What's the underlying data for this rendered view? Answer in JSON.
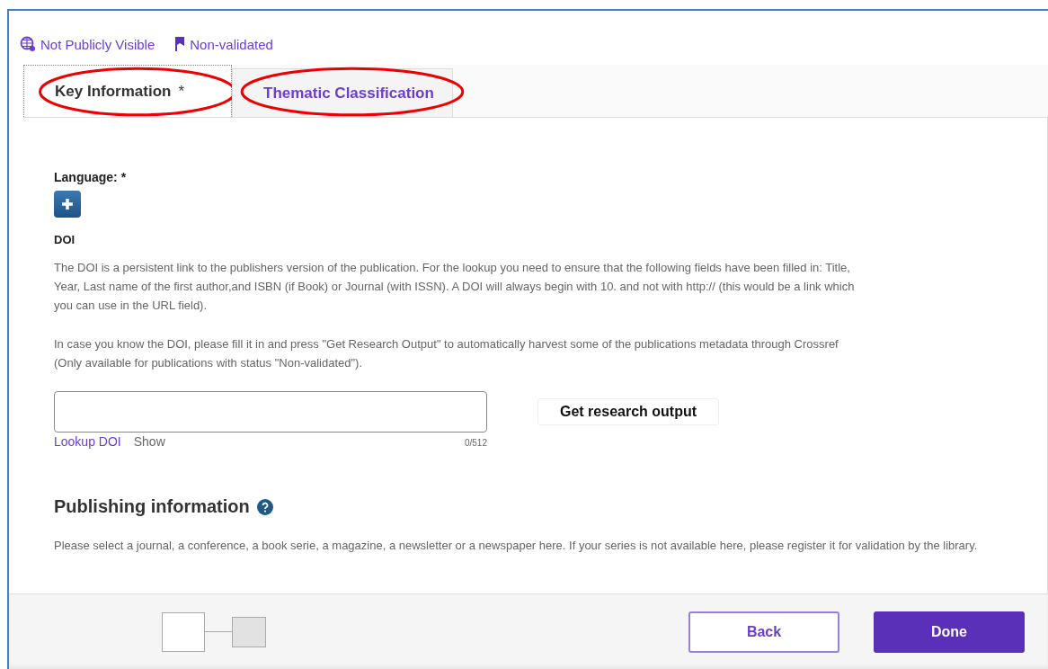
{
  "status": {
    "visibility": "Not Publicly Visible",
    "validation": "Non-validated"
  },
  "tabs": [
    {
      "label": "Key Information",
      "required": true,
      "selected": true,
      "annotated": true
    },
    {
      "label": "Thematic Classification",
      "required": false,
      "selected": false,
      "annotated": true
    }
  ],
  "required_marker": "*",
  "language": {
    "label": "Language:",
    "required": true
  },
  "doi": {
    "heading": "DOI",
    "paragraphs": [
      "The DOI is a persistent link to the publishers version of the publication. For the lookup you need to ensure that the following fields have been filled in: Title, Year, Last name of the first author,and ISBN (if Book) or Journal (with ISSN). A DOI will always begin with 10. and not with http:// (this would be a link which you can use in the URL field).",
      "In case you know the DOI, please fill it in and press \"Get Research Output\" to automatically harvest some of the publications metadata through Crossref (Only available for publications with status \"Non-validated\")."
    ],
    "counter": "0/512",
    "lookup_link": "Lookup DOI",
    "show_link": "Show",
    "button": "Get research output"
  },
  "publishing": {
    "heading": "Publishing information",
    "text": "Please select a journal, a conference, a book serie, a magazine, a newsletter or a newspaper here. If your series is not available here, please register it for validation by the library."
  },
  "footer": {
    "steps": [
      {
        "selected": true
      },
      {
        "selected": false
      }
    ],
    "back": "Back",
    "done": "Done"
  }
}
